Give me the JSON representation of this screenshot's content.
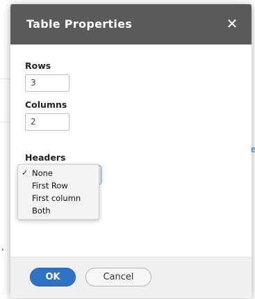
{
  "dialog": {
    "title": "Table Properties",
    "close_glyph": "✕",
    "close_icon": "close-icon"
  },
  "fields": {
    "rows": {
      "label": "Rows",
      "value": "3"
    },
    "columns": {
      "label": "Columns",
      "value": "2"
    },
    "headers": {
      "label": "Headers",
      "selected": "None",
      "options": [
        "None",
        "First Row",
        "First column",
        "Both"
      ]
    }
  },
  "footer": {
    "ok_label": "OK",
    "cancel_label": "Cancel"
  },
  "colors": {
    "titlebar": "#5b5b5b",
    "primary_button": "#2f73c6",
    "focus_ring": "#5aa9e6"
  }
}
